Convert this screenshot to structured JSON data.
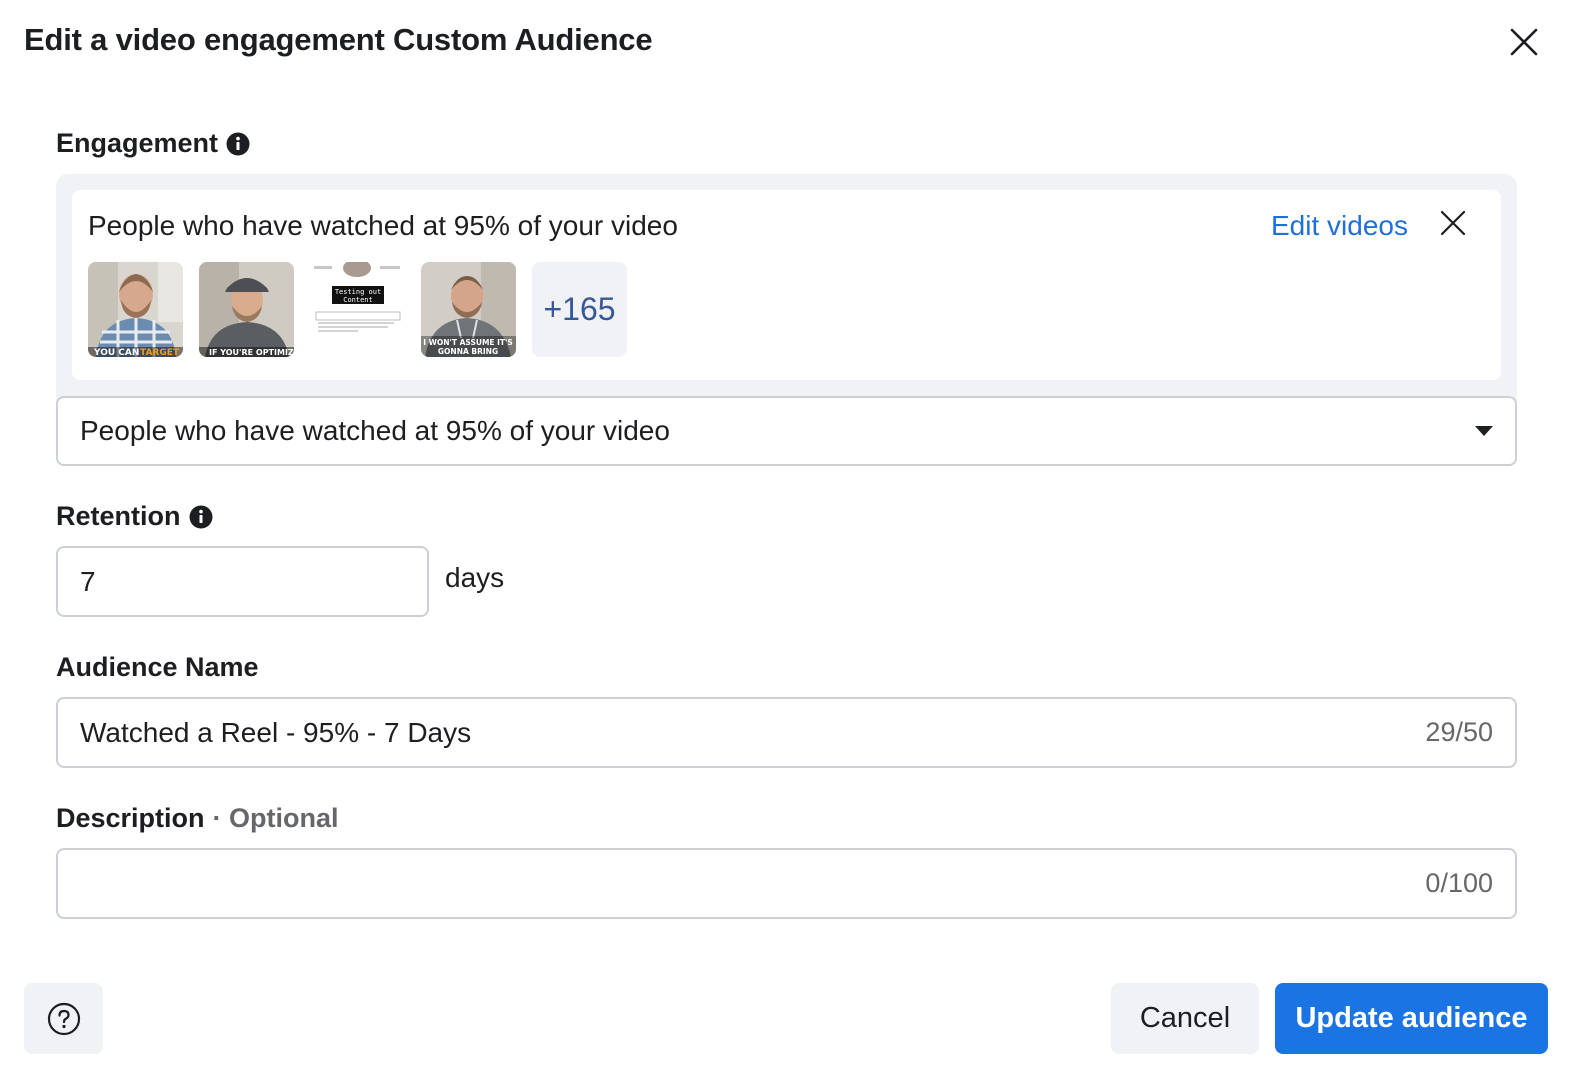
{
  "dialog": {
    "title": "Edit a video engagement Custom Audience",
    "close_icon": "close-icon"
  },
  "engagement": {
    "label": "Engagement",
    "info_icon": "info-icon",
    "summary_text": "People who have watched at 95% of your video",
    "edit_videos_label": "Edit videos",
    "thumbnails": [
      {
        "caption": "YOU CAN TARGET"
      },
      {
        "caption": "IF YOU'RE OPTIMIZING"
      },
      {
        "caption": "Testing out Content"
      },
      {
        "caption": "I WON'T ASSUME IT'S GONNA BRING"
      }
    ],
    "more_count": "+165",
    "select_value": "People who have watched at 95% of your video"
  },
  "retention": {
    "label": "Retention",
    "value": "7",
    "unit": "days"
  },
  "audience_name": {
    "label": "Audience Name",
    "value": "Watched a Reel - 95% - 7 Days",
    "counter": "29/50"
  },
  "description": {
    "label": "Description",
    "optional_label": "· Optional",
    "value": "",
    "counter": "0/100"
  },
  "footer": {
    "help_icon": "help-icon",
    "cancel_label": "Cancel",
    "update_label": "Update audience"
  },
  "colors": {
    "primary": "#1b74e4",
    "link": "#216fdb",
    "panel_bg": "#f0f2f5",
    "border": "#ccd0d5"
  }
}
